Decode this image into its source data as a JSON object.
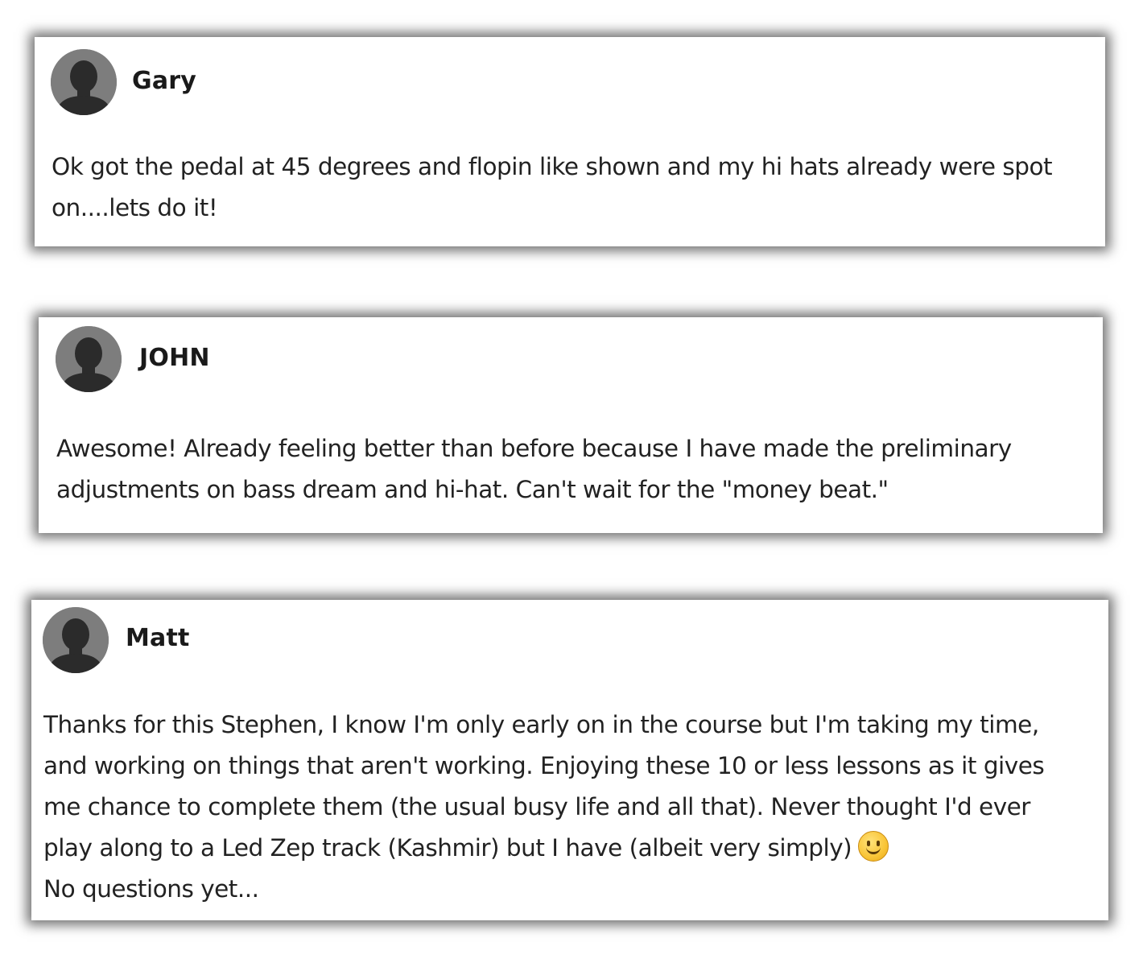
{
  "comments": [
    {
      "author": "Gary",
      "avatar_icon": "user-silhouette-icon",
      "text": "Ok got the pedal at 45 degrees and flopin like shown and my hi hats already were spot\non....lets do it!"
    },
    {
      "author": "JOHN",
      "avatar_icon": "user-silhouette-icon",
      "text": "Awesome! Already feeling better than before because I have made the preliminary\nadjustments on bass dream and hi-hat. Can't wait for the \"money beat.\""
    },
    {
      "author": "Matt",
      "avatar_icon": "user-silhouette-icon",
      "text": "Thanks for this Stephen, I know I'm only early on in the course but I'm taking my time,\nand working on things that aren't working. Enjoying these 10 or less lessons as it gives\nme chance to complete them (the usual busy life and all that). Never thought I'd ever\nplay along to a Led Zep track (Kashmir) but I have (albeit very simply)",
      "text_tail": "No questions yet...",
      "emoji_icon": "slightly-smiling-face-icon"
    }
  ],
  "colors": {
    "avatar_background": "#7d7d7d",
    "avatar_silhouette": "#2b2b2b",
    "card_background": "#ffffff",
    "text": "#222222"
  }
}
